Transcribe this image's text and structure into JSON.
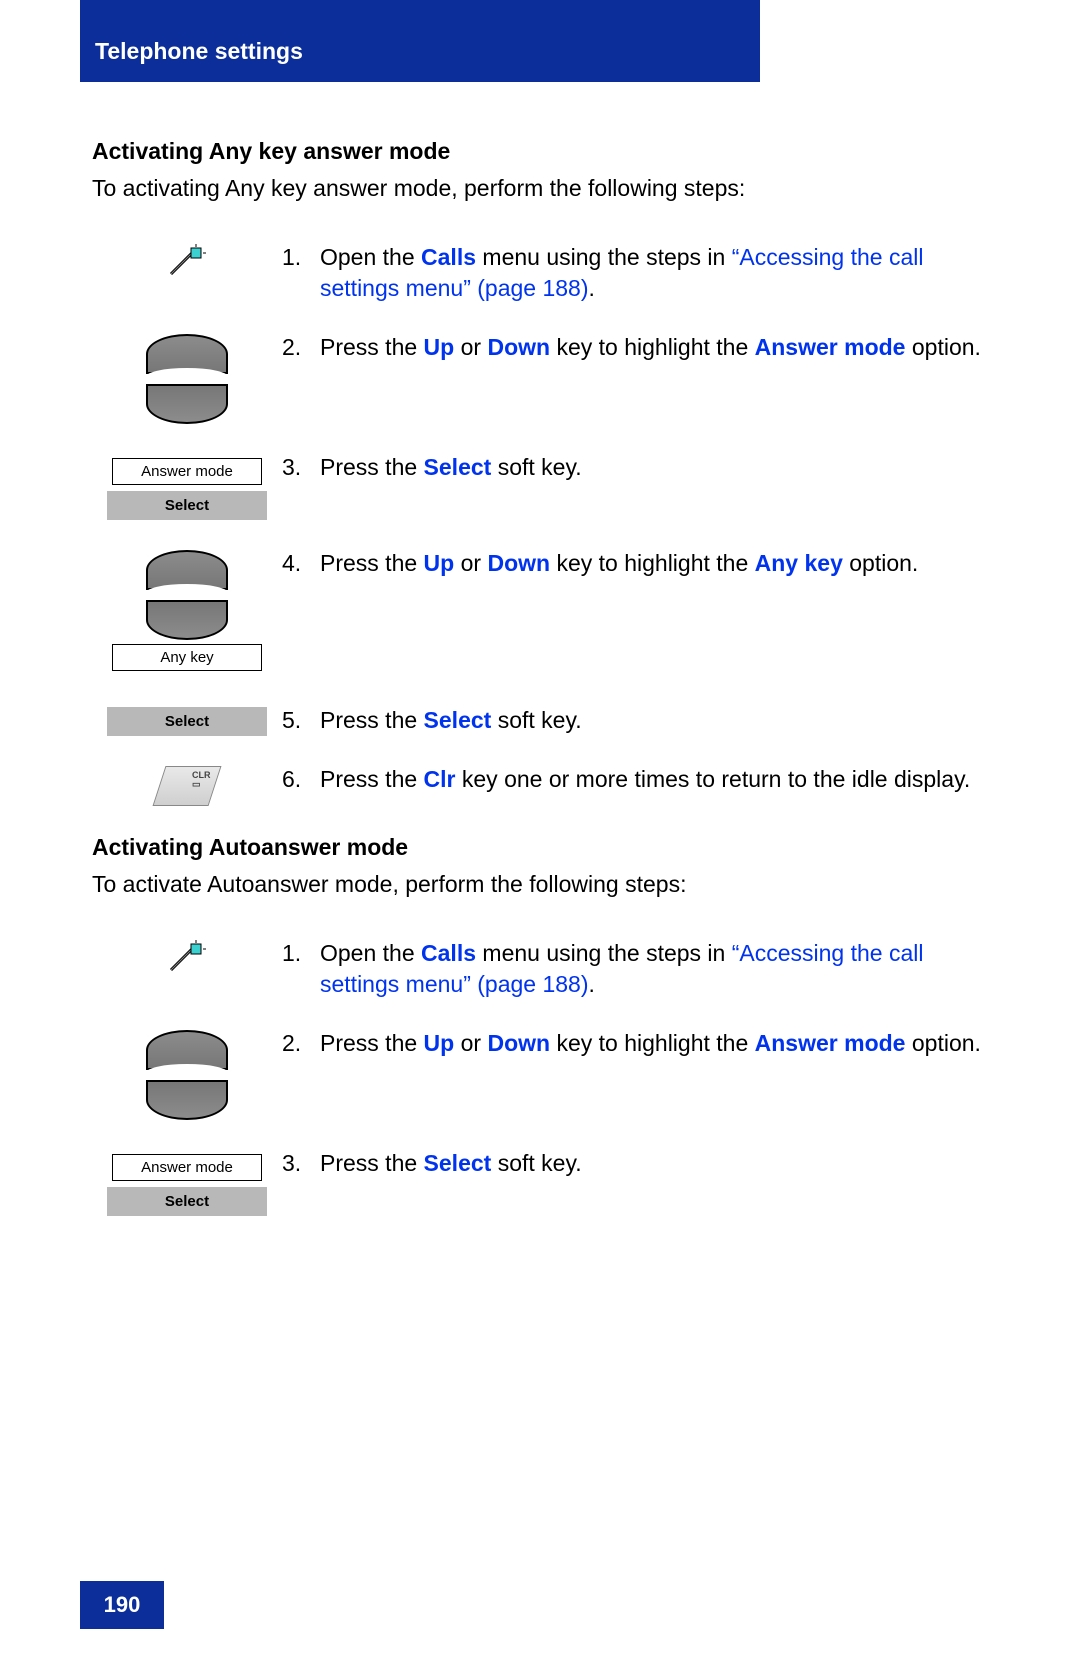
{
  "header": {
    "title": "Telephone settings"
  },
  "footer": {
    "page_number": "190"
  },
  "sections": [
    {
      "heading": "Activating Any key answer mode",
      "intro": "To activating Any key answer mode, perform the following steps:",
      "steps": [
        {
          "num": "1.",
          "pre": "Open the ",
          "kw1": "Calls",
          "mid": " menu using the steps in ",
          "link": "“Accessing the call settings menu” (page 188)",
          "post": ".",
          "icon": "wand"
        },
        {
          "num": "2.",
          "pre": "Press the ",
          "kw1": "Up",
          "mid": " or ",
          "kw2": "Down",
          "mid2": " key to highlight the ",
          "kw3": "Answer mode",
          "post": " option.",
          "icon": "updown"
        },
        {
          "num": "3.",
          "pre": "Press the ",
          "kw1": "Select",
          "post": " soft key.",
          "icon": "display-softkey",
          "display_text": "Answer mode",
          "softkey_text": "Select"
        },
        {
          "num": "4.",
          "pre": "Press the ",
          "kw1": "Up",
          "mid": " or ",
          "kw2": "Down",
          "mid2": " key to highlight the ",
          "kw3": "Any key",
          "post": " option.",
          "icon": "updown-display",
          "display_text": "Any key"
        },
        {
          "num": "5.",
          "pre": "Press the ",
          "kw1": "Select",
          "post": " soft key.",
          "icon": "softkey-only",
          "softkey_text": "Select"
        },
        {
          "num": "6.",
          "pre": "Press the ",
          "kw1": "Clr",
          "post": " key one or more times to return to the idle display.",
          "icon": "clr"
        }
      ]
    },
    {
      "heading": "Activating Autoanswer mode",
      "intro": "To activate Autoanswer mode, perform the following steps:",
      "steps": [
        {
          "num": "1.",
          "pre": "Open the ",
          "kw1": "Calls",
          "mid": " menu using the steps in ",
          "link": "“Accessing the call settings menu” (page 188)",
          "post": ".",
          "icon": "wand"
        },
        {
          "num": "2.",
          "pre": "Press the ",
          "kw1": "Up",
          "mid": " or ",
          "kw2": "Down",
          "mid2": " key to highlight the ",
          "kw3": "Answer mode",
          "post": " option.",
          "icon": "updown"
        },
        {
          "num": "3.",
          "pre": "Press the ",
          "kw1": "Select",
          "post": " soft key.",
          "icon": "display-softkey",
          "display_text": "Answer mode",
          "softkey_text": "Select"
        }
      ]
    }
  ]
}
